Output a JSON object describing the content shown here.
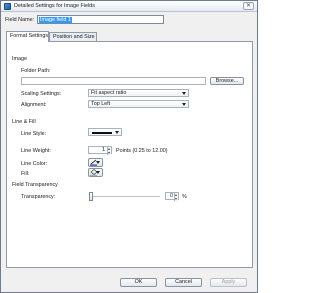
{
  "window": {
    "title": "Detailed Settings for Image Fields"
  },
  "field_name": {
    "label": "Field Name:",
    "value": "Image field 1"
  },
  "tabs": [
    {
      "label": "Format Settings",
      "active": true
    },
    {
      "label": "Position and Size",
      "active": false
    }
  ],
  "image": {
    "section": "Image",
    "folder_path_label": "Folder Path:",
    "folder_path_value": "",
    "browse_label": "Browse...",
    "scaling_label": "Scaling Settings:",
    "scaling_value": "Fit aspect ratio",
    "alignment_label": "Alignment:",
    "alignment_value": "Top Left"
  },
  "line_fill": {
    "section": "Line & Fill",
    "line_style_label": "Line Style:",
    "line_weight_label": "Line Weight:",
    "line_weight_value": "1",
    "line_weight_hint": "Points (0.25 to 12.00)",
    "line_color_label": "Line Color:",
    "fill_label": "Fill:"
  },
  "transparency": {
    "section": "Field Transparency",
    "label": "Transparency:",
    "value": "0",
    "unit": "%",
    "level": 0
  },
  "buttons": {
    "ok": "OK",
    "cancel": "Cancel",
    "apply": "Apply"
  },
  "colors": {
    "selection": "#3399ff",
    "window_bg": "#f0f0f0"
  },
  "icons": [
    "close-icon",
    "dialog-app-icon",
    "pen-icon",
    "paint-bucket-icon"
  ]
}
